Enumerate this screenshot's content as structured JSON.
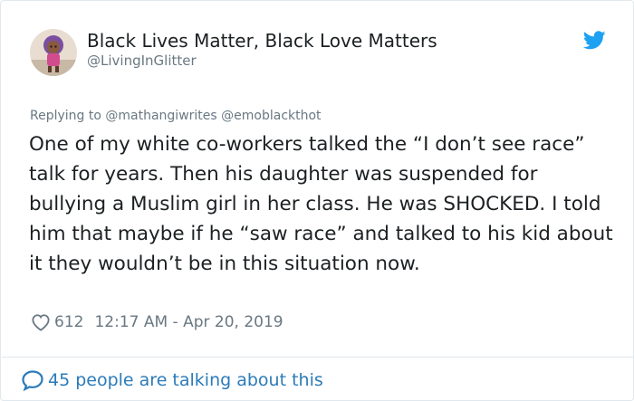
{
  "author": {
    "display_name": "Black Lives Matter, Black Love Matters",
    "handle": "@LivingInGlitter",
    "avatar_icon": "cartoon-avatar"
  },
  "reply": {
    "prefix": "Replying to",
    "mentions": [
      "@mathangiwrites",
      "@emoblackthot"
    ]
  },
  "tweet": {
    "text": "One of my white co-workers talked the “I don’t see race” talk for years. Then his daughter was suspended for bullying a Muslim girl in her class. He was SHOCKED. I told him that maybe if he “saw race” and talked to his kid about it they wouldn’t be in this situation now.",
    "like_count": "612",
    "timestamp": "12:17 AM - Apr 20, 2019"
  },
  "footer": {
    "talking": "45 people are talking about this"
  },
  "icons": {
    "brand": "twitter-bird-icon",
    "like": "heart-icon",
    "talking": "speech-bubble-icon"
  },
  "colors": {
    "twitter_blue": "#1da1f2",
    "link_blue": "#2b7bb9",
    "secondary_text": "#697882",
    "border": "#e1e8ed"
  }
}
